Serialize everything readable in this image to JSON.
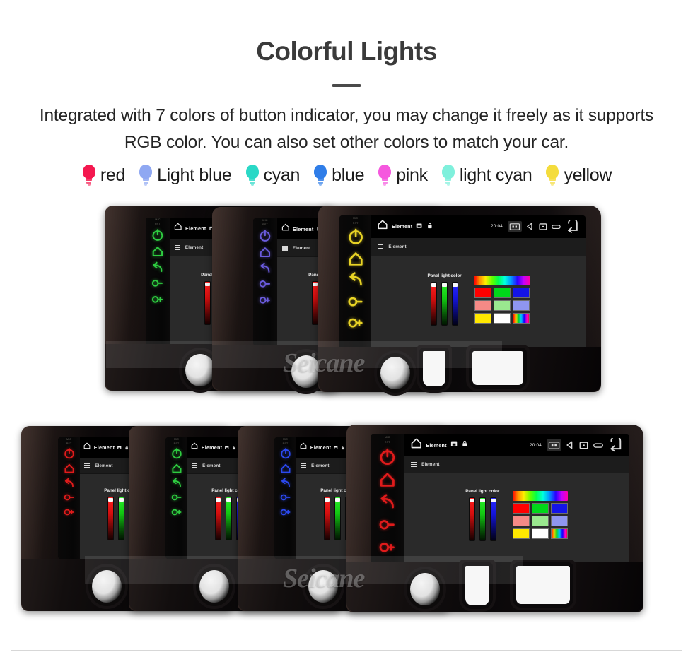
{
  "header": {
    "title": "Colorful Lights",
    "subtitle": "Integrated with 7 colors of button indicator, you may change it freely as it supports RGB color. You can also set other colors to match your car."
  },
  "legend": {
    "items": [
      {
        "label": "red",
        "color": "#f4184f"
      },
      {
        "label": "Light blue",
        "color": "#8fa8f2"
      },
      {
        "label": "cyan",
        "color": "#2ad8c6"
      },
      {
        "label": "blue",
        "color": "#2f7de8"
      },
      {
        "label": "pink",
        "color": "#f558de"
      },
      {
        "label": "light cyan",
        "color": "#7ff0dc"
      },
      {
        "label": "yellow",
        "color": "#f4dc3c"
      }
    ]
  },
  "unit_screen": {
    "status_bar": {
      "home_icon": "home-icon",
      "title": "Element",
      "save_icon": "save-icon",
      "lock_icon": "lock-icon",
      "time": "20:04",
      "nav_icons": [
        "screenshot-icon",
        "back-triangle-icon",
        "home-square-icon",
        "recents-icon",
        "return-arrow-icon"
      ]
    },
    "app_bar": {
      "menu_icon": "hamburger-menu-icon",
      "title": "Element"
    },
    "panel": {
      "label": "Panel light color",
      "sliders": [
        {
          "name": "red-slider",
          "color": "#ff2020",
          "value": 100
        },
        {
          "name": "green-slider",
          "color": "#2bef2b",
          "value": 100
        },
        {
          "name": "blue-slider",
          "color": "#2b2bff",
          "value": 100
        }
      ],
      "gradient_bar": "rainbow",
      "swatches": [
        [
          "#ff0000",
          "#00d819",
          "#1414e8"
        ],
        [
          "#f58a86",
          "#9ae88f",
          "#8f96f0"
        ],
        [
          "#ffe800",
          "#ffffff",
          "rainbow"
        ]
      ]
    }
  },
  "units": {
    "row1": [
      {
        "name": "head-unit-green",
        "led_color": "#2ecc40"
      },
      {
        "name": "head-unit-purple",
        "led_color": "#6a5bdc"
      },
      {
        "name": "head-unit-yellow",
        "led_color": "#e8d325"
      }
    ],
    "row2": [
      {
        "name": "head-unit-red",
        "led_color": "#e01b1b"
      },
      {
        "name": "head-unit-green",
        "led_color": "#2ecc40"
      },
      {
        "name": "head-unit-blue",
        "led_color": "#2b49f0"
      },
      {
        "name": "head-unit-red-2",
        "led_color": "#e01b1b"
      }
    ]
  },
  "watermark": {
    "text": "Seicane"
  },
  "side_buttons": {
    "mini_labels": [
      "MIC",
      "RST"
    ],
    "icons": [
      "power-icon",
      "home-icon",
      "back-icon",
      "volume-down-icon",
      "volume-up-icon"
    ]
  }
}
